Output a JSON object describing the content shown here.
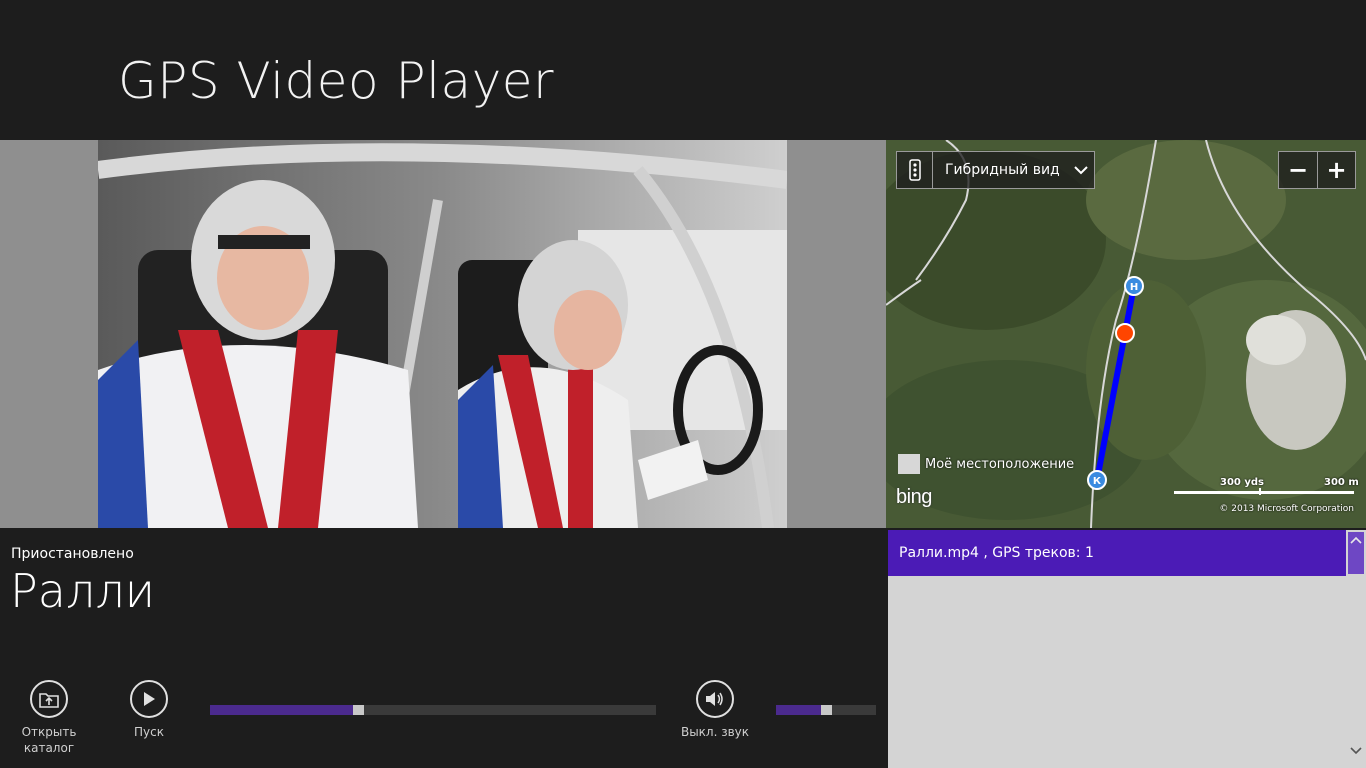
{
  "app": {
    "title": "GPS Video Player"
  },
  "map": {
    "view_mode_label": "Гибридный вид",
    "zoom_out_label": "−",
    "zoom_in_label": "+",
    "my_location_label": "Моё местоположение",
    "logo_text": "bing",
    "scale_yards": "300 yds",
    "scale_meters": "300 m",
    "copyright": "© 2013 Microsoft Corporation",
    "start_marker": "Н",
    "end_marker": "К",
    "colors": {
      "track": "#0000ff",
      "position": "#ff4500",
      "marker": "#3a8be0"
    }
  },
  "player": {
    "status": "Приостановлено",
    "track_title": "Ралли",
    "open_folder_label_1": "Открыть",
    "open_folder_label_2": "каталог",
    "play_label": "Пуск",
    "mute_label": "Выкл. звук",
    "progress_fraction": 0.32,
    "volume_fraction": 0.5
  },
  "list": {
    "items": [
      {
        "label": "Ралли.mp4 , GPS треков: 1"
      }
    ]
  },
  "colors": {
    "accent": "#4b1bb6",
    "background": "#1d1d1d",
    "list_bg": "#d4d4d4"
  }
}
